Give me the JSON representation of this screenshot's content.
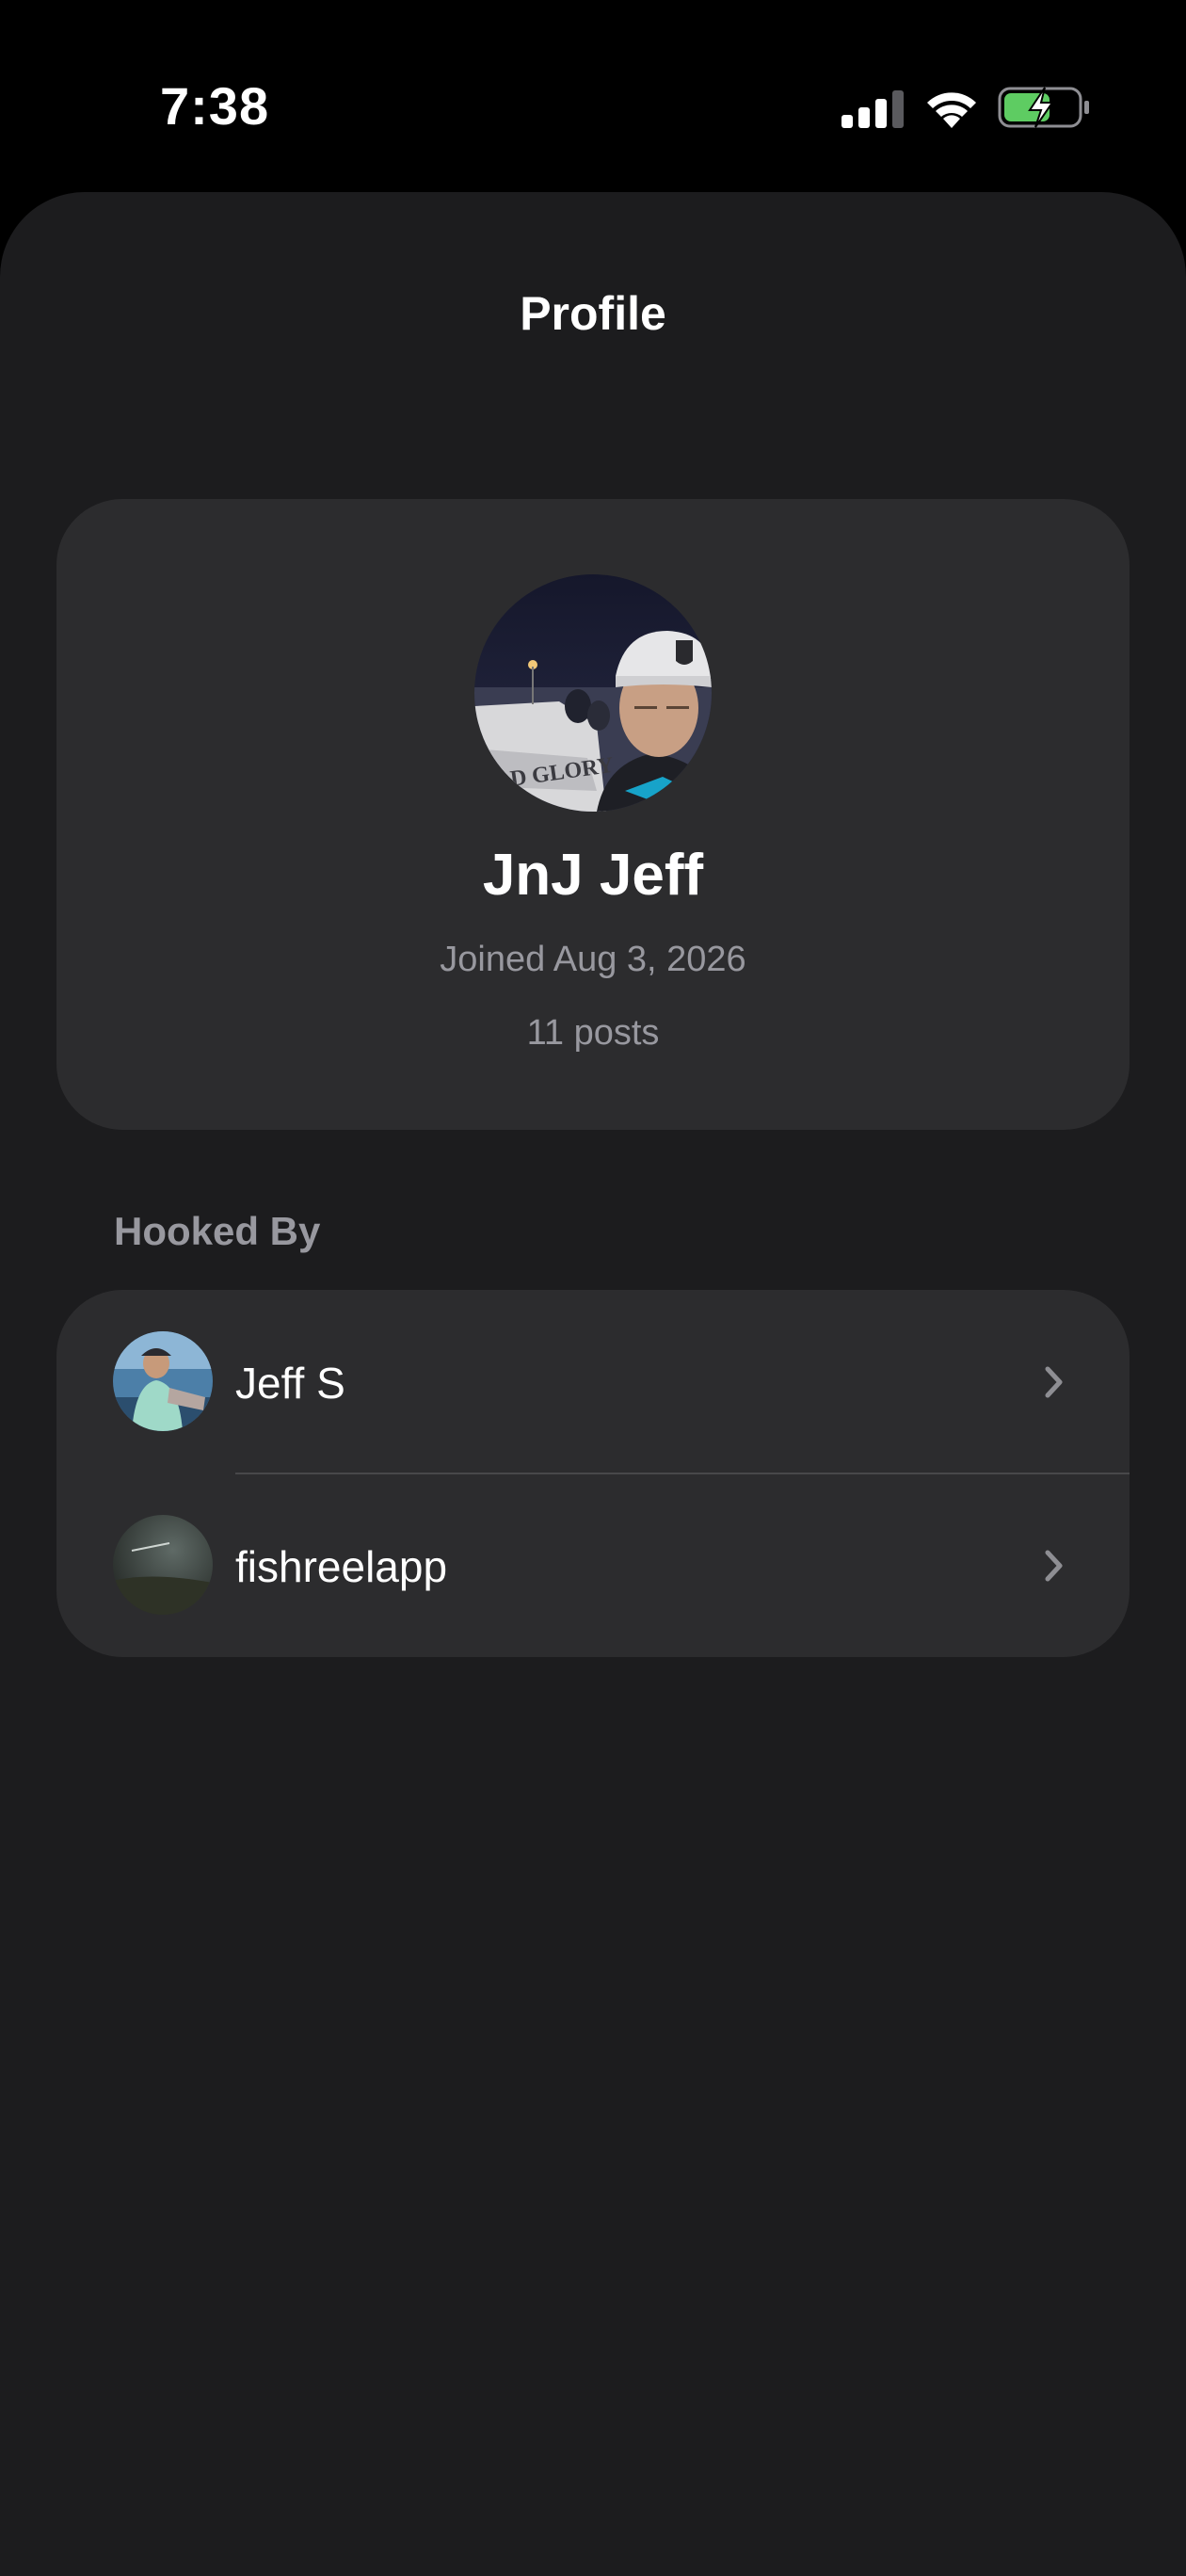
{
  "status_bar": {
    "time": "7:38",
    "icons": [
      "cellular-signal-icon",
      "wifi-icon",
      "battery-charging-icon"
    ],
    "battery_color": "#5ecc62"
  },
  "header": {
    "title": "Profile"
  },
  "profile": {
    "name": "JnJ Jeff",
    "joined": "Joined Aug 3, 2026",
    "posts": "11 posts",
    "boat_text": "D GLORY"
  },
  "hooked_by": {
    "title": "Hooked By",
    "items": [
      {
        "label": "Jeff S"
      },
      {
        "label": "fishreelapp"
      }
    ]
  },
  "colors": {
    "background": "#000000",
    "sheet": "#1c1c1e",
    "card": "#2c2c2e",
    "secondary_text": "#98989f",
    "divider": "#48484a"
  }
}
